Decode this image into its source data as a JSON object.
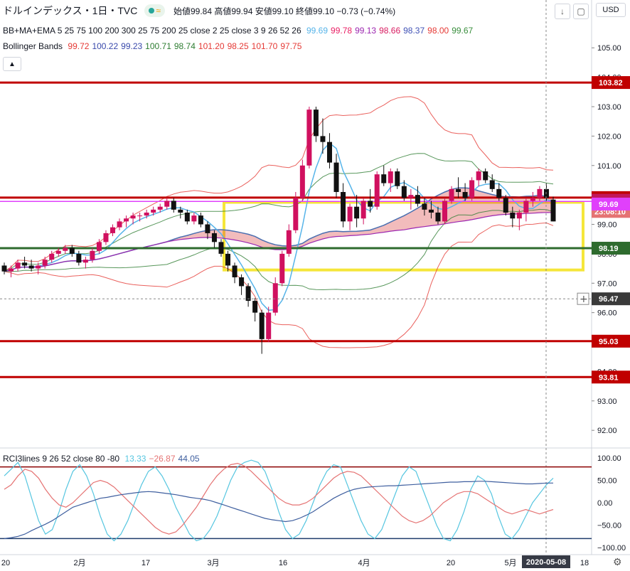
{
  "header": {
    "title": "ドルインデックス・1日・TVC",
    "ohlc": "始値99.84 高値99.94 安値99.10 終値99.10 −0.73 (−0.74%)",
    "currency_label": "USD"
  },
  "indicators": {
    "ma_label": "BB+MA+EMA 5 25 75 100 200 300 25 75 200 25 close 2 25 close 3 9 26 52 26",
    "ma_values": [
      {
        "text": "99.69",
        "color": "#56b4e9"
      },
      {
        "text": "99.78",
        "color": "#e91e63"
      },
      {
        "text": "99.13",
        "color": "#9c27b0"
      },
      {
        "text": "98.66",
        "color": "#d81b60"
      },
      {
        "text": "98.37",
        "color": "#3f51b5"
      },
      {
        "text": "98.00",
        "color": "#e53935"
      },
      {
        "text": "99.67",
        "color": "#388e3c"
      }
    ],
    "bb_label": "Bollinger Bands",
    "bb_values": [
      {
        "text": "99.72",
        "color": "#e53935"
      },
      {
        "text": "100.22",
        "color": "#3949ab"
      },
      {
        "text": "99.23",
        "color": "#3949ab"
      },
      {
        "text": "100.71",
        "color": "#2e7d32"
      },
      {
        "text": "98.74",
        "color": "#2e7d32"
      },
      {
        "text": "101.20",
        "color": "#e53935"
      },
      {
        "text": "98.25",
        "color": "#e53935"
      },
      {
        "text": "101.70",
        "color": "#e53935"
      },
      {
        "text": "97.75",
        "color": "#e53935"
      }
    ],
    "rci_label": "RCI3lines 9 26 52 close 80 -80",
    "rci_values": [
      {
        "text": "13.33",
        "color": "#56c6e0"
      },
      {
        "text": "−26.87",
        "color": "#e57373"
      },
      {
        "text": "44.05",
        "color": "#3f5f9f"
      }
    ]
  },
  "colors": {
    "up": "#d0105f",
    "down": "#111111",
    "hline": "#c00000",
    "green_line": "#2e6b2e",
    "highlight_box": "#f5e63a",
    "cloud_red": "#d94040",
    "cloud_dark": "#555555"
  },
  "chart_data": [
    {
      "type": "candlestick",
      "title": "ドルインデックス 1日",
      "price_axis": {
        "min": 91.4,
        "max": 105.9,
        "ticks": [
          "105.00",
          "104.00",
          "103.00",
          "102.00",
          "101.00",
          "100.00",
          "99.00",
          "98.00",
          "97.00",
          "96.00",
          "95.00",
          "94.00",
          "93.00",
          "92.00"
        ]
      },
      "time_axis": [
        "20",
        "2月",
        "17",
        "3月",
        "16",
        "4月",
        "20",
        "5月",
        "18"
      ],
      "date_badge": "2020-05-08",
      "horizontal_lines": [
        {
          "value": 103.82,
          "label": "103.82",
          "color": "#c00000"
        },
        {
          "value": 99.91,
          "label": "99.91",
          "color": "#c00000"
        },
        {
          "value": 95.03,
          "label": "95.03",
          "color": "#c00000"
        },
        {
          "value": 93.81,
          "label": "93.81",
          "color": "#c00000"
        },
        {
          "value": 98.19,
          "label": "98.19",
          "color": "#2e6b2e"
        }
      ],
      "price_tags": [
        {
          "value": 99.82,
          "label": "99.82",
          "color": "#c2185b"
        },
        {
          "value": 99.44,
          "label": "23:08:10",
          "color": "#e57373"
        },
        {
          "value": 99.69,
          "label": "99.69",
          "color": "#e040fb"
        },
        {
          "value": 96.47,
          "label": "96.47",
          "color": "#3a3a3a"
        }
      ],
      "highlight_box": {
        "price_top": 99.75,
        "price_bottom": 97.45,
        "from": "2020-03-03",
        "to": "2020-05-18"
      },
      "candles_ohlc": [
        [
          97.6,
          97.7,
          97.3,
          97.4
        ],
        [
          97.4,
          97.6,
          97.2,
          97.5
        ],
        [
          97.5,
          97.8,
          97.4,
          97.7
        ],
        [
          97.7,
          97.9,
          97.5,
          97.6
        ],
        [
          97.6,
          97.8,
          97.4,
          97.5
        ],
        [
          97.5,
          97.7,
          97.3,
          97.6
        ],
        [
          97.6,
          97.9,
          97.5,
          97.8
        ],
        [
          97.8,
          98.1,
          97.7,
          98.0
        ],
        [
          98.0,
          98.2,
          97.9,
          98.1
        ],
        [
          98.1,
          98.3,
          98.0,
          98.2
        ],
        [
          98.2,
          98.3,
          97.9,
          98.0
        ],
        [
          98.0,
          98.1,
          97.6,
          97.7
        ],
        [
          97.7,
          97.9,
          97.5,
          97.8
        ],
        [
          97.8,
          98.2,
          97.7,
          98.1
        ],
        [
          98.1,
          98.5,
          98.0,
          98.4
        ],
        [
          98.4,
          98.8,
          98.3,
          98.7
        ],
        [
          98.7,
          99.0,
          98.6,
          98.9
        ],
        [
          98.9,
          99.2,
          98.8,
          99.1
        ],
        [
          99.1,
          99.3,
          98.9,
          99.2
        ],
        [
          99.2,
          99.4,
          99.0,
          99.3
        ],
        [
          99.3,
          99.4,
          99.1,
          99.3
        ],
        [
          99.3,
          99.5,
          99.2,
          99.4
        ],
        [
          99.4,
          99.6,
          99.3,
          99.5
        ],
        [
          99.5,
          99.7,
          99.4,
          99.6
        ],
        [
          99.6,
          99.9,
          99.5,
          99.8
        ],
        [
          99.8,
          99.9,
          99.4,
          99.5
        ],
        [
          99.5,
          99.6,
          99.2,
          99.4
        ],
        [
          99.4,
          99.5,
          99.0,
          99.1
        ],
        [
          99.1,
          99.4,
          99.0,
          99.3
        ],
        [
          99.3,
          99.4,
          98.9,
          99.0
        ],
        [
          99.0,
          99.1,
          98.5,
          98.7
        ],
        [
          98.7,
          98.8,
          98.2,
          98.4
        ],
        [
          98.4,
          98.5,
          97.9,
          98.0
        ],
        [
          98.0,
          98.1,
          97.4,
          97.6
        ],
        [
          97.6,
          97.7,
          97.0,
          97.2
        ],
        [
          97.2,
          97.3,
          96.6,
          96.9
        ],
        [
          96.9,
          97.0,
          96.2,
          96.4
        ],
        [
          96.4,
          96.5,
          95.7,
          96.0
        ],
        [
          96.0,
          96.1,
          94.6,
          95.1
        ],
        [
          95.1,
          96.2,
          95.0,
          96.0
        ],
        [
          96.0,
          97.2,
          95.9,
          97.0
        ],
        [
          97.0,
          98.1,
          96.9,
          98.0
        ],
        [
          98.0,
          99.0,
          97.9,
          98.8
        ],
        [
          98.8,
          100.1,
          98.7,
          99.9
        ],
        [
          99.9,
          101.2,
          99.8,
          101.0
        ],
        [
          101.0,
          103.0,
          100.9,
          102.9
        ],
        [
          102.9,
          103.0,
          101.8,
          102.0
        ],
        [
          102.0,
          102.6,
          101.4,
          101.8
        ],
        [
          101.8,
          102.1,
          100.9,
          101.1
        ],
        [
          101.1,
          101.4,
          99.9,
          100.1
        ],
        [
          100.1,
          100.4,
          98.9,
          99.1
        ],
        [
          99.1,
          99.7,
          98.8,
          99.6
        ],
        [
          99.6,
          100.0,
          98.9,
          99.2
        ],
        [
          99.2,
          99.9,
          99.0,
          99.8
        ],
        [
          99.8,
          100.2,
          99.4,
          99.6
        ],
        [
          99.6,
          100.8,
          99.5,
          100.7
        ],
        [
          100.7,
          101.0,
          100.3,
          100.4
        ],
        [
          100.4,
          100.9,
          100.1,
          100.8
        ],
        [
          100.8,
          100.9,
          100.2,
          100.3
        ],
        [
          100.3,
          100.5,
          99.8,
          99.9
        ],
        [
          99.9,
          100.2,
          99.5,
          100.0
        ],
        [
          100.0,
          100.3,
          99.6,
          99.7
        ],
        [
          99.7,
          99.9,
          99.3,
          99.5
        ],
        [
          99.5,
          99.8,
          99.2,
          99.4
        ],
        [
          99.4,
          99.6,
          99.0,
          99.1
        ],
        [
          99.1,
          99.9,
          99.0,
          99.8
        ],
        [
          99.8,
          100.3,
          99.7,
          100.2
        ],
        [
          100.2,
          100.6,
          99.9,
          100.1
        ],
        [
          100.1,
          100.4,
          99.8,
          99.9
        ],
        [
          99.9,
          100.6,
          99.8,
          100.5
        ],
        [
          100.5,
          100.9,
          100.3,
          100.8
        ],
        [
          100.8,
          100.9,
          100.4,
          100.5
        ],
        [
          100.5,
          100.7,
          100.1,
          100.2
        ],
        [
          100.2,
          100.4,
          99.8,
          99.9
        ],
        [
          99.9,
          100.0,
          99.3,
          99.4
        ],
        [
          99.4,
          99.6,
          98.9,
          99.2
        ],
        [
          99.2,
          99.5,
          98.8,
          99.4
        ],
        [
          99.4,
          99.9,
          99.1,
          99.8
        ],
        [
          99.8,
          100.1,
          99.6,
          99.9
        ],
        [
          99.9,
          100.3,
          99.8,
          100.2
        ],
        [
          100.2,
          100.4,
          99.8,
          99.9
        ],
        [
          99.84,
          99.94,
          99.1,
          99.1
        ]
      ],
      "moving_averages": [
        {
          "name": "BB mid",
          "color": "#4a6fb0"
        },
        {
          "name": "MA5",
          "color": "#56b4e9"
        },
        {
          "name": "MA25",
          "color": "#9c27b0"
        },
        {
          "name": "BB1",
          "color": "#2e7d32"
        },
        {
          "name": "BB2",
          "color": "#e53935"
        }
      ]
    },
    {
      "type": "line",
      "title": "RCI3lines 9 26 52 close 80 -80",
      "y_axis": {
        "min": -100,
        "max": 100,
        "ticks": [
          "100.00",
          "50.00",
          "0.00",
          "−50.00",
          "−100.00"
        ]
      },
      "reference_lines": [
        80,
        -80
      ],
      "series": [
        {
          "name": "RCI9",
          "color": "#56c6e0",
          "values": [
            60,
            75,
            90,
            60,
            10,
            -40,
            -70,
            -60,
            -20,
            30,
            70,
            85,
            60,
            20,
            -30,
            -70,
            -85,
            -70,
            -40,
            0,
            40,
            70,
            80,
            60,
            30,
            -10,
            -40,
            -70,
            -85,
            -80,
            -60,
            -30,
            10,
            50,
            80,
            90,
            95,
            90,
            70,
            30,
            -20,
            -60,
            -80,
            -70,
            -40,
            0,
            40,
            70,
            85,
            80,
            40,
            0,
            -40,
            -70,
            -80,
            -60,
            -20,
            20,
            60,
            80,
            70,
            30,
            -10,
            -50,
            -80,
            -85,
            -60,
            -20,
            30,
            60,
            50,
            20,
            -30,
            -70,
            -80,
            -60,
            -30,
            0,
            20,
            40,
            55
          ]
        },
        {
          "name": "RCI26",
          "color": "#e57373",
          "values": [
            30,
            40,
            60,
            75,
            70,
            55,
            30,
            10,
            -5,
            -10,
            0,
            15,
            30,
            45,
            50,
            45,
            35,
            20,
            5,
            -10,
            -25,
            -40,
            -55,
            -65,
            -70,
            -65,
            -50,
            -30,
            -10,
            15,
            40,
            60,
            75,
            85,
            88,
            82,
            70,
            55,
            40,
            25,
            10,
            0,
            -5,
            -5,
            0,
            10,
            25,
            40,
            55,
            65,
            70,
            68,
            60,
            45,
            30,
            15,
            0,
            -15,
            -30,
            -40,
            -45,
            -40,
            -30,
            -15,
            0,
            10,
            20,
            25,
            25,
            20,
            10,
            0,
            -10,
            -20,
            -25,
            -20,
            -15,
            -20,
            -25,
            -20,
            -15
          ]
        },
        {
          "name": "RCI52",
          "color": "#3f5f9f",
          "values": [
            -80,
            -78,
            -75,
            -70,
            -62,
            -55,
            -48,
            -40,
            -30,
            -20,
            -10,
            -5,
            0,
            5,
            10,
            12,
            15,
            18,
            20,
            22,
            24,
            25,
            24,
            22,
            20,
            18,
            15,
            12,
            10,
            8,
            5,
            0,
            -5,
            -10,
            -15,
            -20,
            -25,
            -30,
            -35,
            -38,
            -40,
            -42,
            -40,
            -35,
            -28,
            -20,
            -10,
            0,
            10,
            18,
            25,
            30,
            33,
            35,
            36,
            37,
            38,
            38,
            39,
            40,
            41,
            42,
            43,
            44,
            45,
            46,
            46,
            47,
            47,
            48,
            48,
            47,
            46,
            45,
            44,
            43,
            42,
            42,
            43,
            44,
            44
          ]
        }
      ]
    }
  ]
}
